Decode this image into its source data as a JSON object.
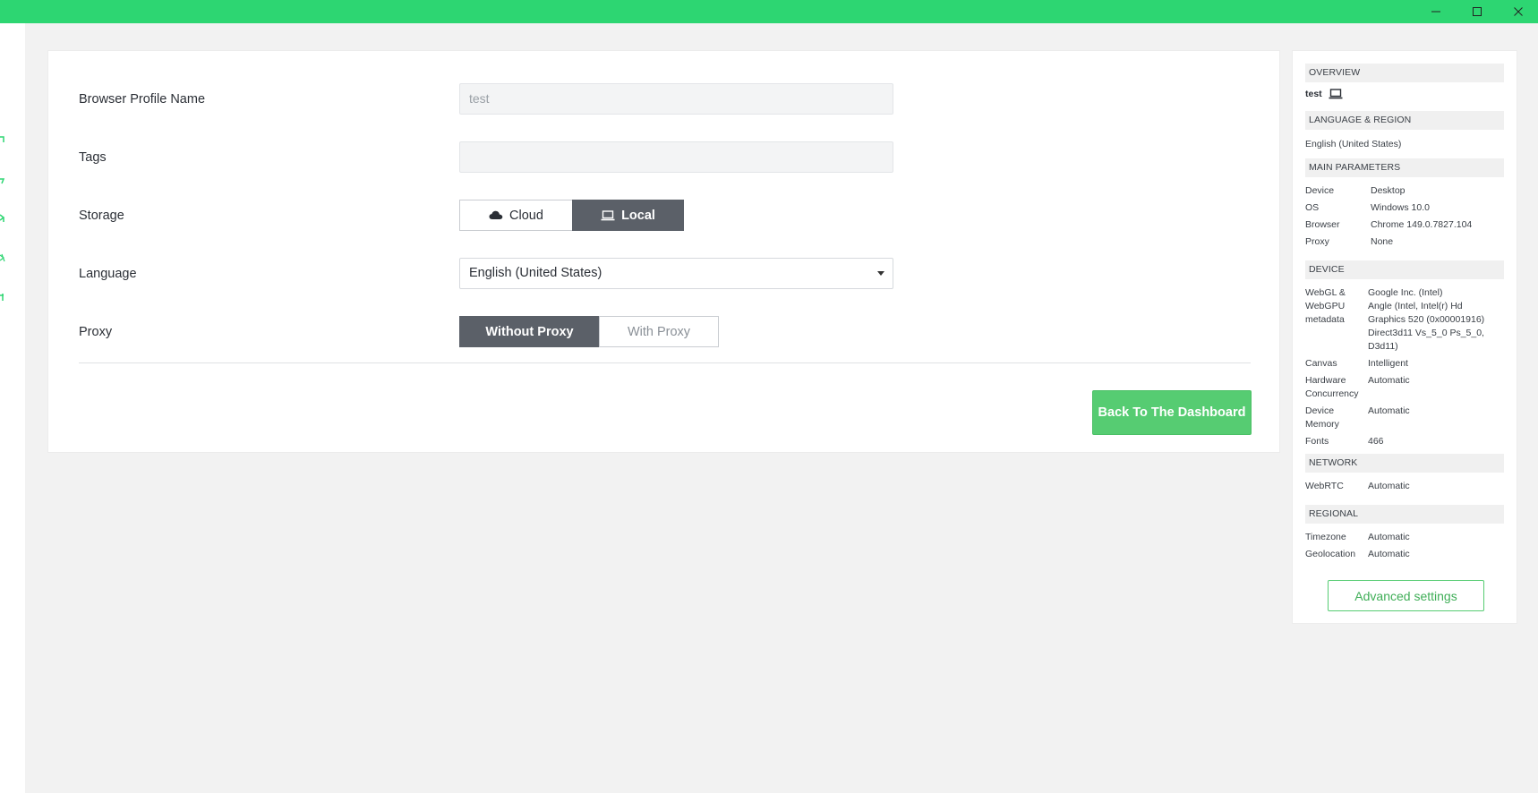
{
  "window": {
    "accent_color": "#2dd672",
    "controls": [
      "minimize-icon",
      "maximize-icon",
      "close-icon"
    ]
  },
  "left_rail": {
    "icons": [
      "rail-icon",
      "rail-icon",
      "rail-icon",
      "rail-icon",
      "rail-icon"
    ]
  },
  "form": {
    "profile_name_label": "Browser Profile Name",
    "profile_name_value": "test",
    "tags_label": "Tags",
    "tags_value": "",
    "storage_label": "Storage",
    "storage_options": {
      "cloud": "Cloud",
      "local": "Local"
    },
    "storage_selected": "Local",
    "language_label": "Language",
    "language_value": "English (United States)",
    "proxy_label": "Proxy",
    "proxy_options": {
      "without": "Without Proxy",
      "with": "With Proxy"
    },
    "proxy_selected": "Without Proxy",
    "back_button": "Back To The Dashboard"
  },
  "overview": {
    "header": "OVERVIEW",
    "profile_name": "test",
    "profile_icon": "laptop-icon",
    "language_region": {
      "header": "LANGUAGE & REGION",
      "value": "English (United States)"
    },
    "main_parameters": {
      "header": "MAIN PARAMETERS",
      "device_label": "Device",
      "device_value": "Desktop",
      "os_label": "OS",
      "os_value": "Windows 10.0",
      "browser_label": "Browser",
      "browser_value": "Chrome 149.0.7827.104",
      "proxy_label": "Proxy",
      "proxy_value": "None"
    },
    "device": {
      "header": "DEVICE",
      "webgl_label_1": "WebGL &",
      "webgl_label_2": "WebGPU",
      "webgl_label_3": "metadata",
      "webgl_value_1": "Google Inc. (Intel)",
      "webgl_value_2": "Angle (Intel, Intel(r) Hd",
      "webgl_value_3": "Graphics 520 (0x00001916)",
      "webgl_value_4": "Direct3d11 Vs_5_0 Ps_5_0,",
      "webgl_value_5": "D3d11)",
      "canvas_label": "Canvas",
      "canvas_value": "Intelligent",
      "hw_label_1": "Hardware",
      "hw_label_2": "Concurrency",
      "hw_value": "Automatic",
      "mem_label_1": "Device",
      "mem_label_2": "Memory",
      "mem_value": "Automatic",
      "fonts_label": "Fonts",
      "fonts_value": "466"
    },
    "network": {
      "header": "NETWORK",
      "webrtc_label": "WebRTC",
      "webrtc_value": "Automatic"
    },
    "regional": {
      "header": "REGIONAL",
      "timezone_label": "Timezone",
      "timezone_value": "Automatic",
      "geo_label": "Geolocation",
      "geo_value": "Automatic"
    },
    "advanced_button": "Advanced settings"
  }
}
